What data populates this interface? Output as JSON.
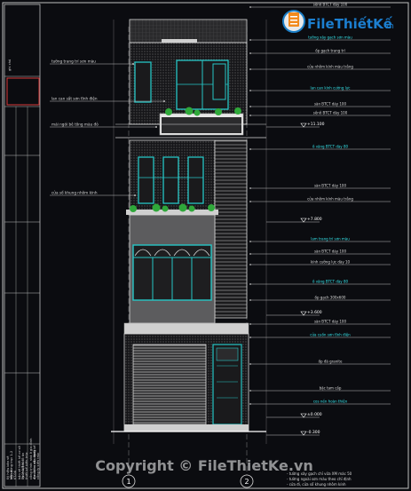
{
  "logo": {
    "brand": "FileThiếtKế",
    "tld": ".vn"
  },
  "watermark": "Copyright © FileThietKe.vn",
  "title_block": {
    "col1": [
      "Ký hiệu bản vẽ",
      "hồ sơ"
    ],
    "col2": [
      "Mặt đứng trục 1-2",
      "KT-04"
    ],
    "col3": [
      "bản vẽ thiết kế cơ sở",
      "Tỷ lệ 1/100"
    ],
    "col4": [
      "chủ nhiệm đồ án",
      "thiết kế kiến trúc"
    ],
    "col5": [
      "công trình: nhà ở gia đình",
      "địa điểm xây dựng"
    ],
    "col6": [
      "đơn vị tư vấn thiết kế",
      "công ty kiến trúc"
    ],
    "col7": [
      "ghi chú"
    ]
  },
  "left_labels": [
    "tường trang trí sơn màu",
    "lan can sắt sơn tĩnh điện",
    "mái ngói bê tông màu đỏ",
    "cửa sổ khung nhôm kính"
  ],
  "right_labels": [
    "sênô BTCT dày 100",
    "tường xây gạch sơn màu",
    "ốp gạch trang trí",
    "cửa nhôm kính màu trắng",
    "lan can kính cường lực",
    "sàn BTCT dày 100",
    "sênô BTCT dày 100",
    "ô văng BTCT dày 80",
    "sàn BTCT dày 100",
    "cửa nhôm kính màu trắng",
    "lam trang trí sơn màu",
    "sàn BTCT dày 100",
    "kính cường lực dày 10",
    "ô văng BTCT dày 80",
    "ốp gạch 300x600",
    "sàn BTCT dày 100",
    "cửa cuốn sơn tĩnh điện",
    "ốp đá granite",
    "bậc tam cấp",
    "cos nền hoàn thiện"
  ],
  "levels": [
    "+11.100",
    "+7.800",
    "+3.600",
    "±0.000",
    "-0.300"
  ],
  "axes": [
    "1",
    "2"
  ],
  "notes": [
    "- tường xây gạch chỉ vữa XM mác 50",
    "- tường ngoài sơn màu theo chỉ định",
    "- cửa đi, cửa sổ khung nhôm kính"
  ]
}
